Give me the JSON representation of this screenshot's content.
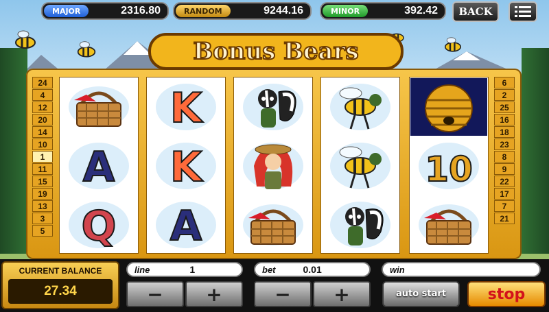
{
  "jackpots": {
    "major": {
      "label": "MAJOR",
      "value": "2316.80"
    },
    "random": {
      "label": "RANDOM",
      "value": "9244.16"
    },
    "minor": {
      "label": "MINOR",
      "value": "392.42"
    }
  },
  "nav": {
    "back_label": "BACK",
    "menu_icon": "hamburger-menu-icon"
  },
  "logo": {
    "text": "Bonus Bears"
  },
  "paylines": {
    "left": [
      "24",
      "4",
      "12",
      "20",
      "14",
      "10",
      "1",
      "11",
      "15",
      "19",
      "13",
      "3",
      "5"
    ],
    "right": [
      "6",
      "2",
      "25",
      "16",
      "18",
      "23",
      "8",
      "9",
      "22",
      "17",
      "7",
      "21"
    ],
    "highlighted": "1"
  },
  "reels": [
    [
      {
        "icon": "picnic-basket-icon"
      },
      {
        "icon": "letter-a-icon",
        "text": "A",
        "color": "#2a2e7a"
      },
      {
        "icon": "letter-q-icon",
        "text": "Q",
        "color": "#d2454e"
      }
    ],
    [
      {
        "icon": "letter-k-icon",
        "text": "K",
        "color": "#ff6a3a"
      },
      {
        "icon": "letter-k-icon",
        "text": "K",
        "color": "#ff6a3a"
      },
      {
        "icon": "letter-a-icon",
        "text": "A",
        "color": "#2a2e7a"
      }
    ],
    [
      {
        "icon": "skunk-icon"
      },
      {
        "icon": "ranger-girl-icon"
      },
      {
        "icon": "picnic-basket-icon"
      }
    ],
    [
      {
        "icon": "bee-icon"
      },
      {
        "icon": "bee-icon"
      },
      {
        "icon": "skunk-icon"
      }
    ],
    [
      {
        "icon": "beehive-icon"
      },
      {
        "icon": "number-ten-icon",
        "text": "10",
        "color": "#e6a422"
      },
      {
        "icon": "picnic-basket-icon"
      }
    ]
  ],
  "balance": {
    "title": "CURRENT BALANCE",
    "value": "27.34"
  },
  "fields": {
    "line": {
      "label": "line",
      "value": "1"
    },
    "bet": {
      "label": "bet",
      "value": "0.01"
    },
    "win": {
      "label": "win",
      "value": ""
    }
  },
  "controls": {
    "minus": "−",
    "plus": "+",
    "auto_start": "auto start",
    "stop": "stop"
  }
}
